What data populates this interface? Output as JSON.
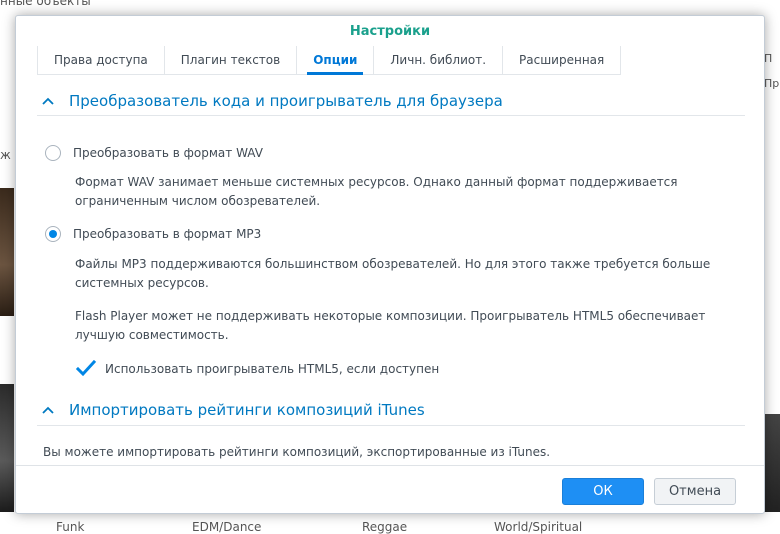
{
  "background": {
    "top_text": "нные объекты",
    "left_text": "ж",
    "right_text_1": "П",
    "right_text_2": "Пр",
    "genres": [
      "Funk",
      "EDM/Dance",
      "Reggae",
      "World/Spiritual"
    ]
  },
  "dialog": {
    "title": "Настройки",
    "tabs": [
      {
        "label": "Права доступа",
        "active": false
      },
      {
        "label": "Плагин текстов",
        "active": false
      },
      {
        "label": "Опции",
        "active": true
      },
      {
        "label": "Личн. библиот.",
        "active": false
      },
      {
        "label": "Расширенная",
        "active": false
      }
    ],
    "section1": {
      "title": "Преобразователь кода и проигрыватель для браузера",
      "option_wav": {
        "label": "Преобразовать в формат WAV",
        "checked": false,
        "desc_line1": "Формат WAV занимает меньше системных ресурсов. Однако данный формат поддерживается",
        "desc_line2": "ограниченным числом обозревателей."
      },
      "option_mp3": {
        "label": "Преобразовать в формат MP3",
        "checked": true,
        "desc_line1": "Файлы MP3 поддерживаются большинством обозревателей. Но для этого также требуется больше",
        "desc_line2": "системных ресурсов."
      },
      "flash_note_line1": "Flash Player может не поддерживать некоторые композиции. Проигрыватель HTML5 обеспечивает",
      "flash_note_line2": "лучшую совместимость.",
      "html5_checkbox": {
        "label": "Использовать проигрыватель HTML5, если доступен",
        "checked": true
      }
    },
    "section2": {
      "title": "Импортировать рейтинги композиций iTunes",
      "text": "Вы можете импортировать рейтинги композиций, экспортированные из iTunes."
    },
    "buttons": {
      "ok": "ОК",
      "cancel": "Отмена"
    },
    "colors": {
      "title": "#1aa08c",
      "accent": "#0079c1",
      "ok_button": "#1e8ff4"
    }
  }
}
